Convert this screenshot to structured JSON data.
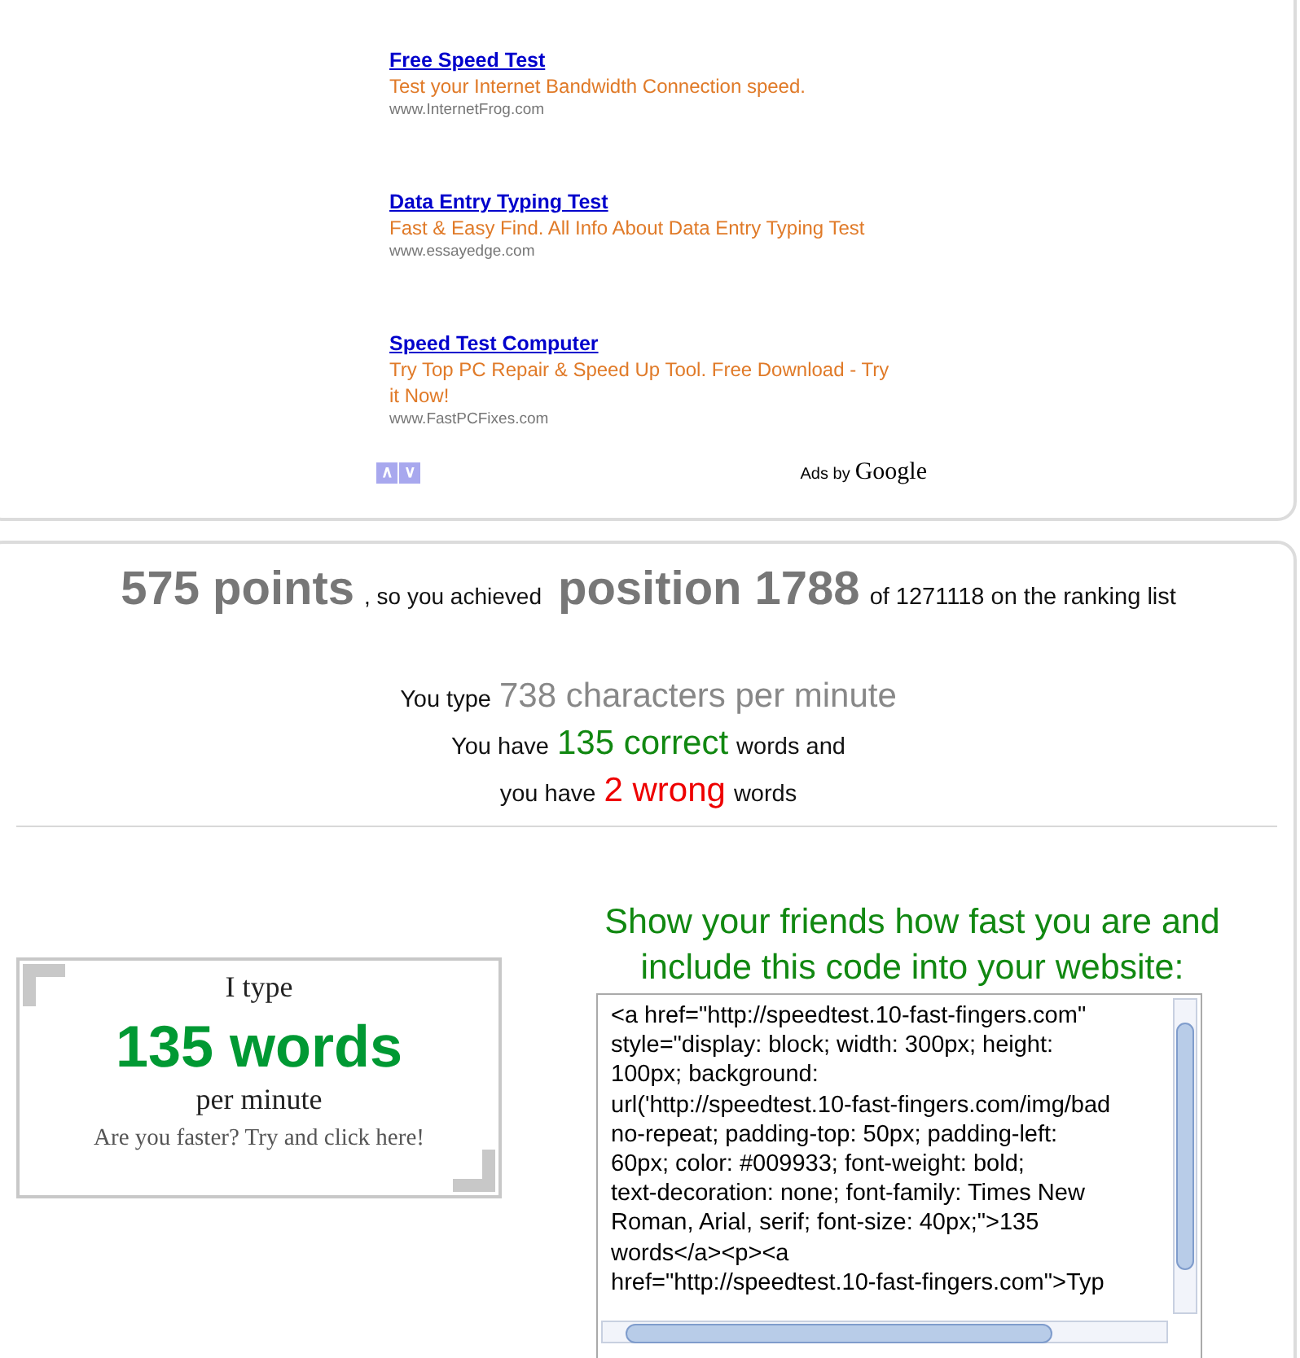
{
  "ads": [
    {
      "title": "Free Speed Test",
      "text": "Test your Internet Bandwidth Connection speed.",
      "url": "www.InternetFrog.com"
    },
    {
      "title": "Data Entry Typing Test",
      "text": "Fast & Easy Find. All Info About Data Entry Typing Test",
      "url": "www.essayedge.com"
    },
    {
      "title": "Speed Test Computer",
      "text": "Try Top PC Repair & Speed Up Tool. Free Download - Try it Now!",
      "url": "www.FastPCFixes.com"
    }
  ],
  "ad_nav": [
    "∧",
    "∨"
  ],
  "ads_by": {
    "label": "Ads by",
    "brand": "Google"
  },
  "result_lines": [
    [
      {
        "text": "575 points",
        "kind": "big"
      },
      {
        "text": ", so you achieved",
        "kind": "small"
      },
      {
        "text": "position 1788",
        "kind": "big"
      },
      {
        "text": "of 1271118 on the ranking list",
        "kind": "plain"
      }
    ],
    [
      {
        "text": "You type",
        "kind": "plain"
      },
      {
        "text": "738 characters per minute",
        "kind": "gray"
      }
    ],
    [
      {
        "text": "You have",
        "kind": "plain"
      },
      {
        "text": "135 correct",
        "kind": "correct"
      },
      {
        "text": "words and",
        "kind": "plain"
      }
    ],
    [
      {
        "text": "you have",
        "kind": "plain"
      },
      {
        "text": "2 wrong",
        "kind": "wrong"
      },
      {
        "text": "words",
        "kind": "plain"
      }
    ]
  ],
  "badge": {
    "line1": "I type",
    "count": "135 words",
    "line2": "per minute",
    "link": "Are you faster? Try and click here!"
  },
  "share": {
    "heading": "Show your friends how fast you are and include this code into your website:",
    "code_lines": [
      "<a href=\"http://speedtest.10-fast-fingers.com\"",
      "style=\"display: block; width: 300px; height:",
      "100px; background:",
      "url('http://speedtest.10-fast-fingers.com/img/bad",
      "no-repeat; padding-top: 50px; padding-left:",
      "60px; color: #009933; font-weight: bold;",
      "text-decoration: none; font-family: Times New",
      "Roman, Arial, serif; font-size: 40px;\">135",
      "words</a><p><a",
      "href=\"http://speedtest.10-fast-fingers.com\">Typ"
    ]
  }
}
